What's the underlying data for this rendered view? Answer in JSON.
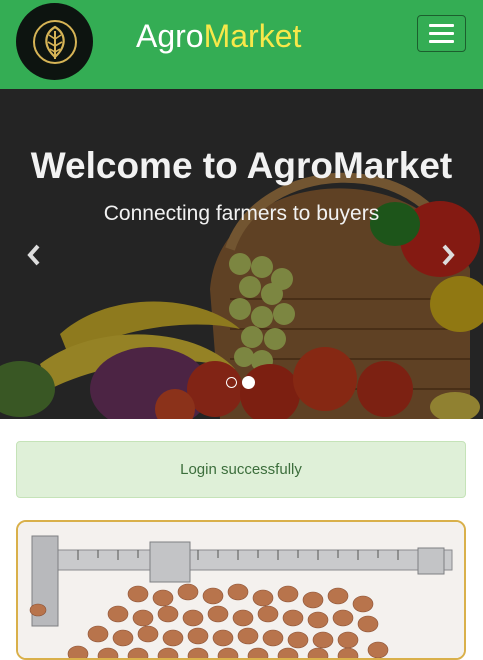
{
  "navbar": {
    "brand_part1": "Agro",
    "brand_part2": "Market",
    "logo_icon": "leaf-icon",
    "menu_icon": "hamburger-icon",
    "menu_label": "Toggle navigation"
  },
  "carousel": {
    "title": "Welcome to AgroMarket",
    "subtitle": "Connecting farmers to buyers",
    "prev_icon": "chevron-left-icon",
    "next_icon": "chevron-right-icon",
    "slide_count": 2,
    "active_slide": 2
  },
  "alert": {
    "message": "Login successfully"
  },
  "colors": {
    "navbar_bg": "#34ad54",
    "brand_accent": "#f7e84a",
    "alert_bg": "#dff0d8",
    "alert_text": "#3c6e3c",
    "card_border": "#d9b04a"
  }
}
